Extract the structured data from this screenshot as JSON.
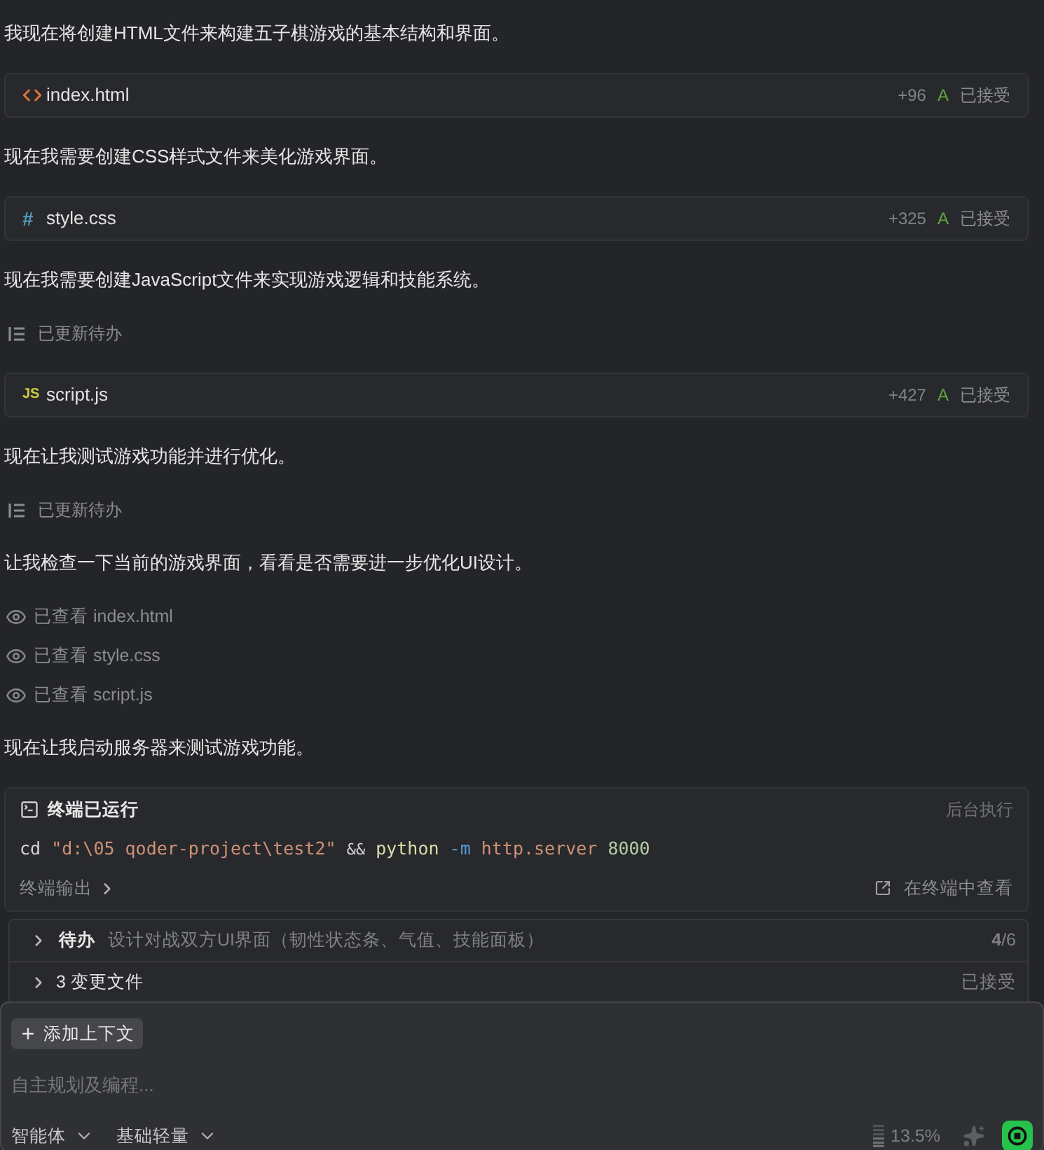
{
  "feed": [
    {
      "kind": "text",
      "text": "我现在将创建HTML文件来构建五子棋游戏的基本结构和界面。"
    },
    {
      "kind": "file",
      "file_icon": {
        "kind": "code"
      },
      "name": "index.html",
      "additions": "+96",
      "status_letter": "A",
      "status": "已接受"
    },
    {
      "kind": "text",
      "text": "现在我需要创建CSS样式文件来美化游戏界面。"
    },
    {
      "kind": "file",
      "file_icon": {
        "kind": "hash",
        "text": "#"
      },
      "name": "style.css",
      "additions": "+325",
      "status_letter": "A",
      "status": "已接受"
    },
    {
      "kind": "text",
      "text": "现在我需要创建JavaScript文件来实现游戏逻辑和技能系统。"
    },
    {
      "kind": "todo_update",
      "text": "已更新待办"
    },
    {
      "kind": "file",
      "file_icon": {
        "kind": "js",
        "text": "JS"
      },
      "name": "script.js",
      "additions": "+427",
      "status_letter": "A",
      "status": "已接受"
    },
    {
      "kind": "text",
      "text": "现在让我测试游戏功能并进行优化。"
    },
    {
      "kind": "todo_update",
      "text": "已更新待办"
    },
    {
      "kind": "text",
      "text": "让我检查一下当前的游戏界面，看看是否需要进一步优化UI设计。"
    },
    {
      "kind": "viewed",
      "text": "已查看 index.html"
    },
    {
      "kind": "viewed",
      "text": "已查看 style.css"
    },
    {
      "kind": "viewed",
      "text": "已查看 script.js"
    },
    {
      "kind": "text",
      "text": "现在让我启动服务器来测试游戏功能。"
    },
    {
      "kind": "terminal",
      "title": "终端已运行",
      "mode": "后台执行",
      "command": [
        {
          "text": "cd",
          "kind": "command"
        },
        {
          "text": "\"d:\\05 qoder-project\\test2\"",
          "kind": "string"
        },
        {
          "text": "&&",
          "kind": "operator"
        },
        {
          "text": "python",
          "kind": "function"
        },
        {
          "text": "-m",
          "kind": "flag"
        },
        {
          "text": "http.server",
          "kind": "argument"
        },
        {
          "text": "8000",
          "kind": "number"
        }
      ],
      "output_link": "终端输出",
      "open_link": "在终端中查看"
    }
  ],
  "todo_panel": {
    "rows": [
      {
        "kind": "todo",
        "expanded": false,
        "title": "待办",
        "description": "设计对战双方UI界面（韧性状态条、气值、技能面板）",
        "progress": "**4**/6"
      },
      {
        "kind": "changes",
        "expanded": false,
        "title": "3 变更文件",
        "status": "已接受"
      }
    ]
  },
  "composer": {
    "add_context": "添加上下文",
    "placeholder": "自主规划及编程...",
    "mode": "智能体",
    "model": "基础轻量",
    "context_usage": "13.5%"
  }
}
